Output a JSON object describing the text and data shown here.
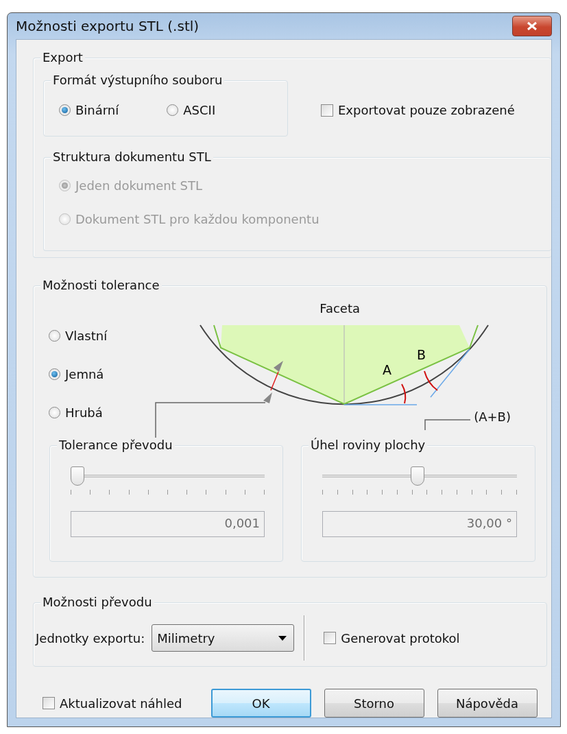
{
  "window": {
    "title": "Možnosti exportu STL (.stl)"
  },
  "export": {
    "label": "Export",
    "format": {
      "label": "Formát výstupního souboru",
      "options": [
        {
          "label": "Binární",
          "selected": true,
          "disabled": false
        },
        {
          "label": "ASCII",
          "selected": false,
          "disabled": false
        }
      ]
    },
    "visible_only": {
      "label": "Exportovat pouze zobrazené",
      "checked": false
    },
    "structure": {
      "label": "Struktura dokumentu STL",
      "options": [
        {
          "label": "Jeden dokument STL",
          "selected": true,
          "disabled": true
        },
        {
          "label": "Dokument STL pro každou komponentu",
          "selected": false,
          "disabled": true
        }
      ]
    }
  },
  "tolerance": {
    "label": "Možnosti tolerance",
    "options": [
      {
        "label": "Vlastní",
        "selected": false
      },
      {
        "label": "Jemná",
        "selected": true
      },
      {
        "label": "Hrubá",
        "selected": false
      }
    ],
    "diagram": {
      "title": "Faceta",
      "label_a": "A",
      "label_b": "B",
      "sum_label": "(A+B)"
    },
    "sliders": [
      {
        "label": "Tolerance převodu",
        "level": 0,
        "value": "0,001"
      },
      {
        "label": "Úhel roviny plochy",
        "level": 0.49,
        "value": "30,00 °"
      }
    ]
  },
  "conversion": {
    "label": "Možnosti převodu",
    "units_label": "Jednotky exportu:",
    "units_value": "Milimetry",
    "protocol": {
      "label": "Generovat protokol",
      "checked": false
    }
  },
  "preview": {
    "label": "Aktualizovat náhled",
    "checked": false
  },
  "buttons": [
    {
      "label": "OK",
      "default": true
    },
    {
      "label": "Storno",
      "default": false
    },
    {
      "label": "Nápověda",
      "default": false
    }
  ]
}
